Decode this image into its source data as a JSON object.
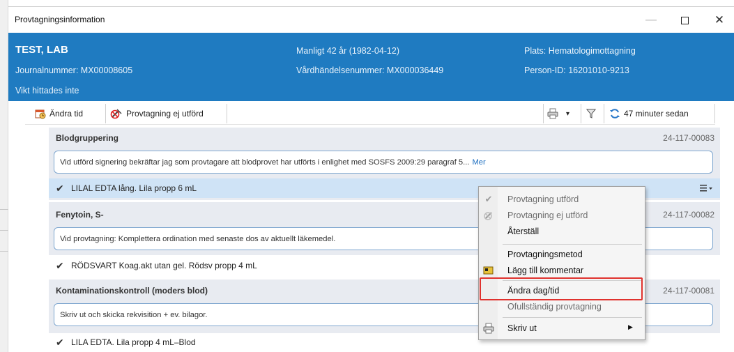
{
  "window": {
    "title": "Provtagningsinformation",
    "controls": {
      "minimize": "—",
      "close": "✕"
    }
  },
  "patient": {
    "name": "TEST, LAB",
    "journal": "Journalnummer: MX00008605",
    "weight_note": "Vikt hittades inte",
    "gender_age": "Manligt 42 år (1982-04-12)",
    "encounter": "Vårdhändelsenummer: MX000036449",
    "location": "Plats: Hematologimottagning",
    "person_id": "Person-ID: 16201010-9213"
  },
  "toolbar": {
    "change_time": "Ändra tid",
    "not_performed": "Provtagning ej utförd",
    "refresh_label": "47 minuter sedan",
    "print_dropdown": "▾"
  },
  "sections": [
    {
      "title": "Blodgruppering",
      "id": "24-117-00083",
      "note": "Vid utförd signering bekräftar jag som provtagare att blodprovet har utförts i enlighet med SOSFS 2009:29 paragraf 5...",
      "note_more": "Mer",
      "item": "LILAL   EDTA lång. Lila propp 6 mL"
    },
    {
      "title": "Fenytoin, S-",
      "id": "24-117-00082",
      "note": "Vid provtagning: Komplettera ordination med senaste dos av aktuellt läkemedel.",
      "item": "RÖDSVART Koag.akt utan gel. Rödsv propp 4 mL"
    },
    {
      "title": "Kontaminationskontroll (moders blod)",
      "id": "24-117-00081",
      "note": "Skriv ut och skicka rekvisition + ev. bilagor.",
      "item": "LILA   EDTA. Lila propp 4 mL–Blod"
    }
  ],
  "context_menu": {
    "items": [
      {
        "label": "Provtagning utförd"
      },
      {
        "label": "Provtagning ej utförd"
      },
      {
        "label": "Återställ"
      },
      {
        "label": "Provtagningsmetod"
      },
      {
        "label": "Lägg till kommentar"
      },
      {
        "label": "Ändra dag/tid"
      },
      {
        "label": "Ofullständig provtagning"
      },
      {
        "label": "Skriv ut"
      }
    ]
  },
  "colors": {
    "header_bg": "#1f7bc1",
    "selected_row": "#cfe3f6",
    "section_bg": "#e8ebf1",
    "highlight_box": "#e0322e"
  }
}
